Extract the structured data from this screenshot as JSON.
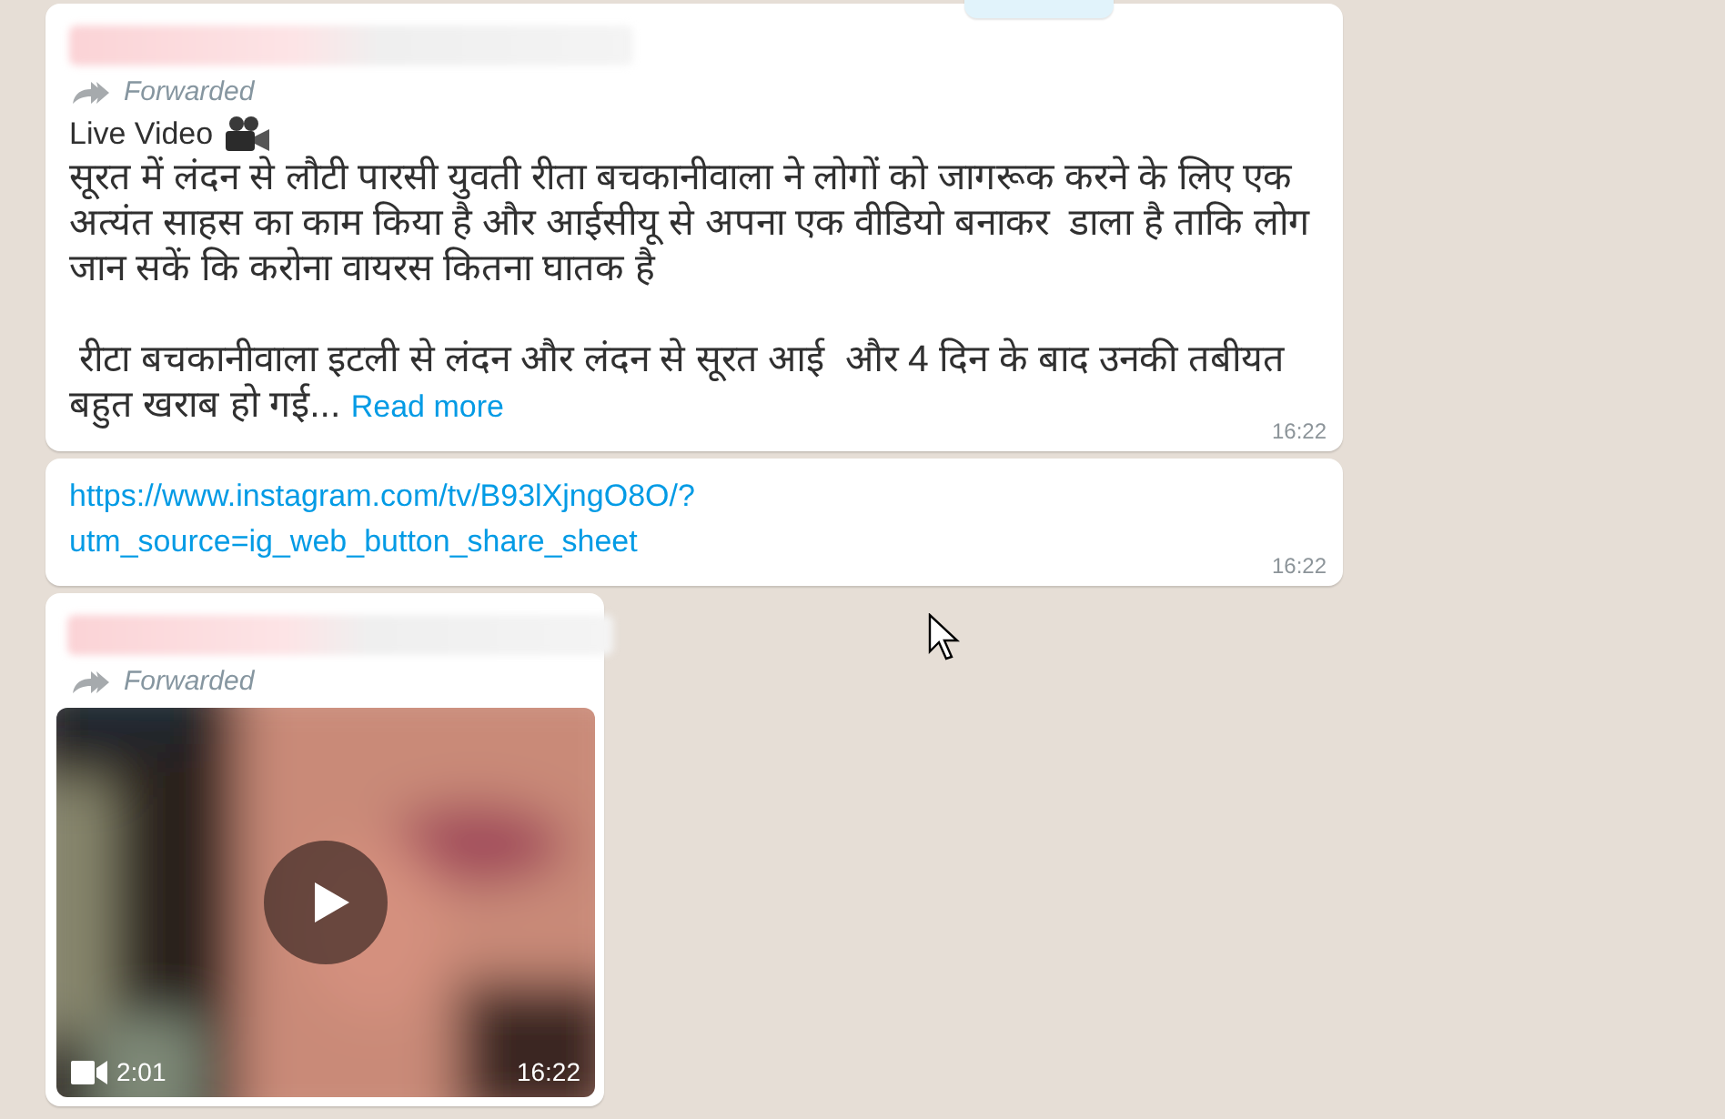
{
  "chat": {
    "messages": [
      {
        "kind": "text",
        "forwarded_label": "Forwarded",
        "title": "Live Video",
        "paragraphs": [
          "सूरत में लंदन से लौटी पारसी युवती रीता बचकानीवाला ने लोगों को जागरूक करने के लिए एक अत्यंत साहस का काम किया है और आईसीयू से अपना एक वीडियो बनाकर  डाला है ताकि लोग जान सकें कि करोना वायरस कितना घातक है",
          " रीटा बचकानीवाला इटली से लंदन और लंदन से सूरत आई  और 4 दिन के बाद उनकी तबीयत बहुत खराब हो गई..."
        ],
        "read_more": "Read more",
        "time": "16:22"
      },
      {
        "kind": "link",
        "url": "https://www.instagram.com/tv/B93lXjngO8O/?utm_source=ig_web_button_share_sheet",
        "time": "16:22"
      },
      {
        "kind": "video",
        "forwarded_label": "Forwarded",
        "duration": "2:01",
        "time": "16:22"
      }
    ]
  }
}
